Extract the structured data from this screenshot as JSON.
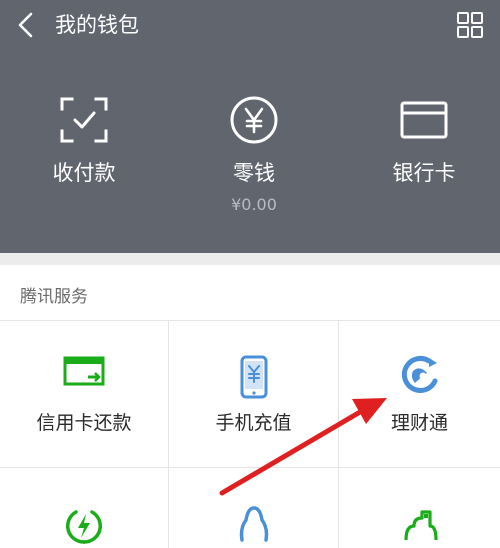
{
  "header": {
    "title": "我的钱包"
  },
  "actions": [
    {
      "label": "收付款",
      "icon": "scan-pay-icon"
    },
    {
      "label": "零钱",
      "icon": "yuan-coin-icon",
      "amount": "¥0.00"
    },
    {
      "label": "银行卡",
      "icon": "bank-card-icon"
    }
  ],
  "services": {
    "section_title": "腾讯服务",
    "items": [
      {
        "label": "信用卡还款",
        "icon": "credit-card-repay-icon"
      },
      {
        "label": "手机充值",
        "icon": "phone-recharge-icon"
      },
      {
        "label": "理财通",
        "icon": "licaitong-icon"
      },
      {
        "label": "",
        "icon": "lightning-icon"
      },
      {
        "label": "",
        "icon": "qq-penguin-icon"
      },
      {
        "label": "",
        "icon": "city-service-icon"
      }
    ]
  },
  "colors": {
    "header_bg": "#60656e",
    "accent_green": "#1aad19",
    "accent_blue": "#4a90d9",
    "arrow_red": "#e02020"
  }
}
